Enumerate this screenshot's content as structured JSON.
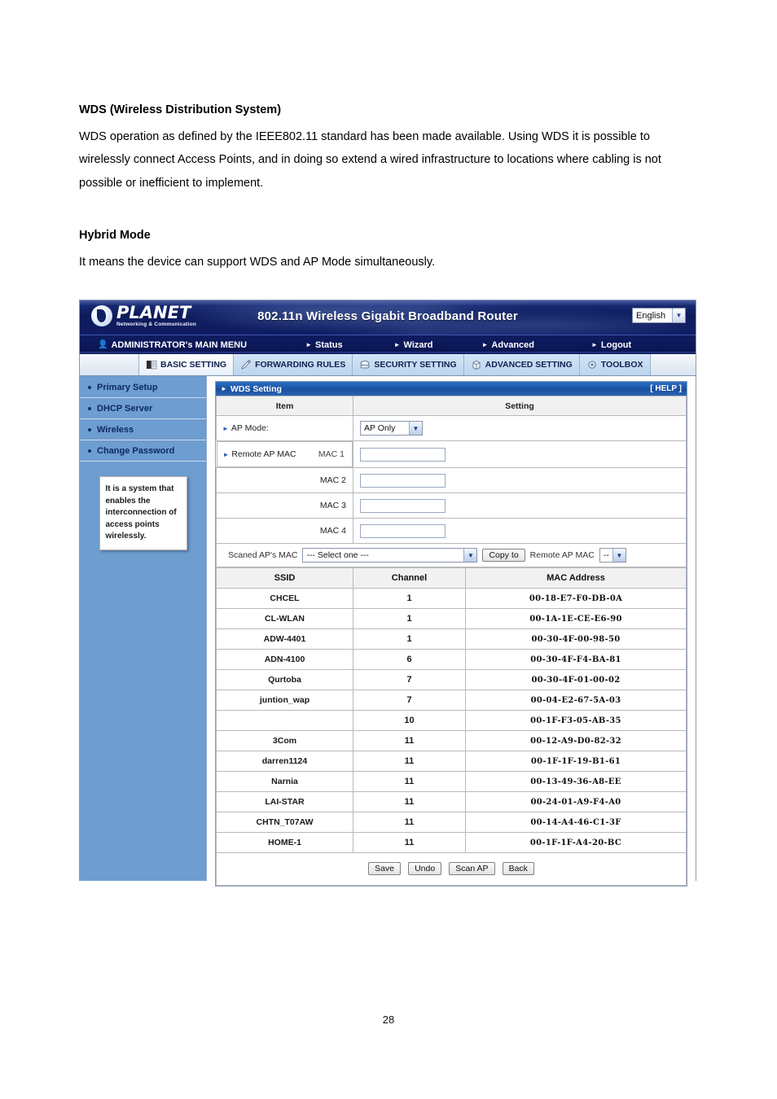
{
  "document": {
    "section1_heading": "WDS (Wireless Distribution System)",
    "section1_body": "WDS operation as defined by the IEEE802.11 standard has been made available. Using WDS it is possible to wirelessly connect Access Points, and in doing so extend a wired infrastructure to locations where cabling is not possible or inefficient to implement.",
    "section2_heading": "Hybrid Mode",
    "section2_body": "It means the device can support WDS and AP Mode simultaneously.",
    "page_number": "28"
  },
  "router": {
    "brand": {
      "name": "PLANET",
      "tagline": "Networking & Communication"
    },
    "title": "802.11n Wireless Gigabit Broadband Router",
    "language": {
      "selected": "English",
      "arrow_icon": "chevron-down-icon"
    },
    "menu": {
      "main": "ADMINISTRATOR's MAIN MENU",
      "items": [
        {
          "label": "Status"
        },
        {
          "label": "Wizard"
        },
        {
          "label": "Advanced"
        },
        {
          "label": "Logout"
        }
      ]
    },
    "tabs": [
      {
        "label": "BASIC SETTING",
        "icon": "book-icon",
        "active": true
      },
      {
        "label": "FORWARDING RULES",
        "icon": "pencil-icon",
        "active": false
      },
      {
        "label": "SECURITY SETTING",
        "icon": "shield-icon",
        "active": false
      },
      {
        "label": "ADVANCED SETTING",
        "icon": "box-icon",
        "active": false
      },
      {
        "label": "TOOLBOX",
        "icon": "tools-icon",
        "active": false
      }
    ],
    "sidebar": {
      "items": [
        {
          "label": "Primary Setup"
        },
        {
          "label": "DHCP Server"
        },
        {
          "label": "Wireless"
        },
        {
          "label": "Change Password"
        }
      ],
      "hint": "It is a system that enables the interconnection of access points wirelessly."
    },
    "panel": {
      "title": "WDS Setting",
      "help_label": "[ HELP ]",
      "table_headers": {
        "item": "Item",
        "setting": "Setting"
      },
      "ap_mode": {
        "label": "AP Mode:",
        "value": "AP Only"
      },
      "remote_ap_mac": {
        "label": "Remote AP MAC",
        "rows": [
          {
            "label": "MAC 1",
            "value": ""
          },
          {
            "label": "MAC 2",
            "value": ""
          },
          {
            "label": "MAC 3",
            "value": ""
          },
          {
            "label": "MAC 4",
            "value": ""
          }
        ]
      },
      "scanned": {
        "label": "Scaned AP's MAC",
        "select_value": "--- Select one ---",
        "copy_button": "Copy to",
        "target_label": "Remote AP MAC",
        "target_value": "--"
      },
      "ap_table": {
        "columns": [
          "SSID",
          "Channel",
          "MAC Address"
        ],
        "rows": [
          {
            "ssid": "CHCEL",
            "channel": "1",
            "mac": "00-18-E7-F0-DB-0A"
          },
          {
            "ssid": "CL-WLAN",
            "channel": "1",
            "mac": "00-1A-1E-CE-E6-90"
          },
          {
            "ssid": "ADW-4401",
            "channel": "1",
            "mac": "00-30-4F-00-98-50"
          },
          {
            "ssid": "ADN-4100",
            "channel": "6",
            "mac": "00-30-4F-F4-BA-81"
          },
          {
            "ssid": "Qurtoba",
            "channel": "7",
            "mac": "00-30-4F-01-00-02"
          },
          {
            "ssid": "juntion_wap",
            "channel": "7",
            "mac": "00-04-E2-67-5A-03"
          },
          {
            "ssid": "",
            "channel": "10",
            "mac": "00-1F-F3-05-AB-35"
          },
          {
            "ssid": "3Com",
            "channel": "11",
            "mac": "00-12-A9-D0-82-32"
          },
          {
            "ssid": "darren1124",
            "channel": "11",
            "mac": "00-1F-1F-19-B1-61"
          },
          {
            "ssid": "Narnia",
            "channel": "11",
            "mac": "00-13-49-36-A8-EE"
          },
          {
            "ssid": "LAI-STAR",
            "channel": "11",
            "mac": "00-24-01-A9-F4-A0"
          },
          {
            "ssid": "CHTN_T07AW",
            "channel": "11",
            "mac": "00-14-A4-46-C1-3F"
          },
          {
            "ssid": "HOME-1",
            "channel": "11",
            "mac": "00-1F-1F-A4-20-BC"
          }
        ]
      },
      "buttons": [
        {
          "label": "Save"
        },
        {
          "label": "Undo"
        },
        {
          "label": "Scan AP"
        },
        {
          "label": "Back"
        }
      ]
    }
  }
}
